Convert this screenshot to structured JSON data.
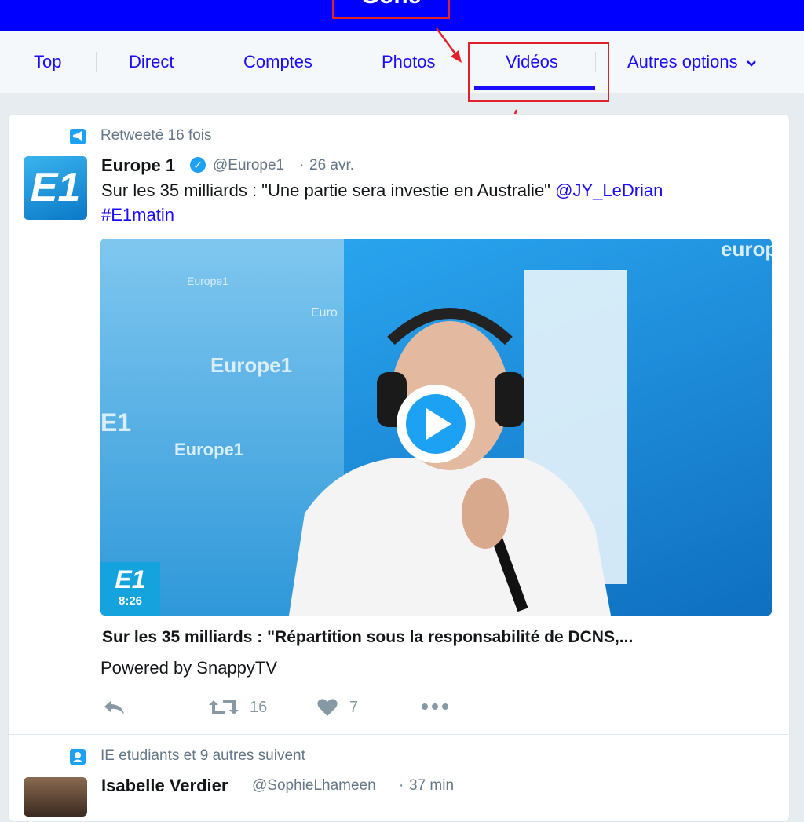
{
  "header": {
    "boxed_text": "Gone"
  },
  "tabs": [
    {
      "label": "Top"
    },
    {
      "label": "Direct"
    },
    {
      "label": "Comptes"
    },
    {
      "label": "Photos"
    },
    {
      "label": "Vidéos"
    },
    {
      "label": "Autres options"
    }
  ],
  "active_tab": "Vidéos",
  "tweet1": {
    "context": "Retweeté 16 fois",
    "name": "Europe 1",
    "handle": "@Europe1",
    "sep": "·",
    "time": "26 avr.",
    "text_before": "Sur les 35 milliards : \"Une partie sera investie en Australie\" ",
    "mention": "@JY_LeDrian",
    "hashtag": "#E1matin",
    "avatar_text": "E1",
    "video": {
      "badge_logo": "E1",
      "badge_time": "8:26",
      "bg_words": [
        "Europe1",
        "Europe1",
        "Europe1",
        "Euro",
        "europ",
        "E1"
      ]
    },
    "video_title": "Sur les 35 milliards : \"Répartition sous la responsabilité de DCNS,...",
    "powered_by": "Powered by SnappyTV",
    "retweets": "16",
    "likes": "7"
  },
  "tweet2": {
    "context": "IE etudiants et 9 autres suivent",
    "name": "Isabelle Verdier",
    "handle": "@SophieLhameen",
    "sep": "·",
    "time": "37 min"
  },
  "colors": {
    "accent": "#1c0cff",
    "highlight": "#e0202a",
    "twitter_blue": "#1da1f2"
  }
}
